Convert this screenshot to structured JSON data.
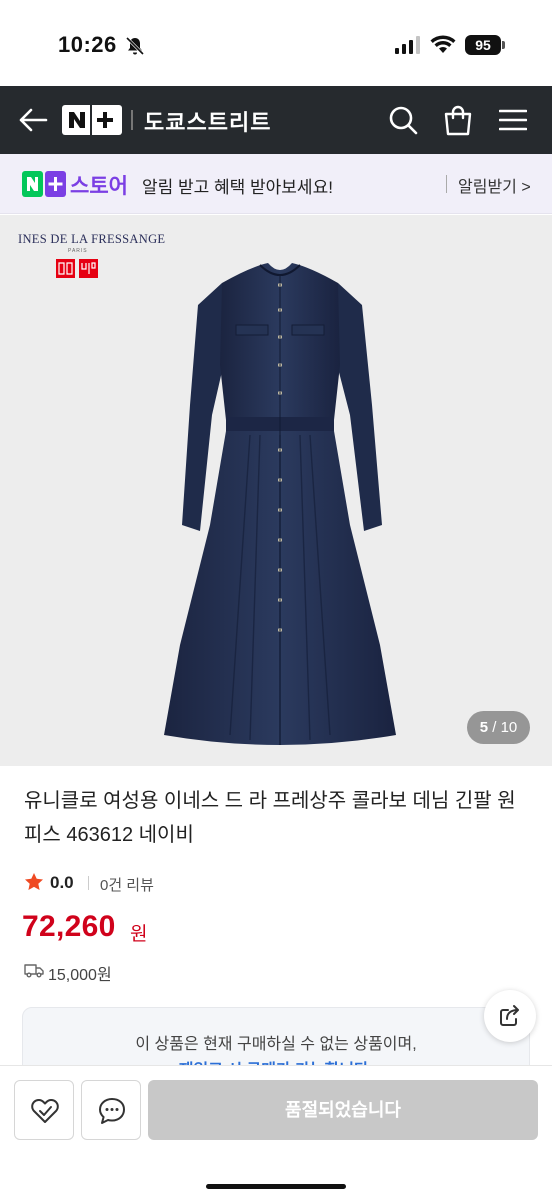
{
  "status_bar": {
    "time": "10:26",
    "battery": "95"
  },
  "nav": {
    "logo_text": "N+",
    "title": "도쿄스트리트"
  },
  "promo": {
    "brand": "스토어",
    "message": "알림 받고 혜택 받아보세요!",
    "action": "알림받기 >"
  },
  "product_image": {
    "brand_collab": "INES DE LA FRESSANGE",
    "brand_sub": "PARIS",
    "counter_current": "5",
    "counter_total": "/ 10"
  },
  "product": {
    "title": "유니클로 여성용 이네스 드 라 프레상주 콜라보 데님 긴팔 원피스 463612 네이비",
    "rating": "0.0",
    "reviews": "0건 리뷰",
    "price": "72,260",
    "price_unit": "원",
    "shipping": "15,000원"
  },
  "notice": {
    "line1": "이 상품은 현재 구매하실 수 없는 상품이며,",
    "line2": "재입고 시 구매가 가능합니다."
  },
  "bottom_bar": {
    "soldout_label": "품절되었습니다"
  },
  "colors": {
    "nav_bg": "#262a2e",
    "price": "#d0021b",
    "promo_accent": "#7b3fe4",
    "naver_green": "#03c75a"
  }
}
